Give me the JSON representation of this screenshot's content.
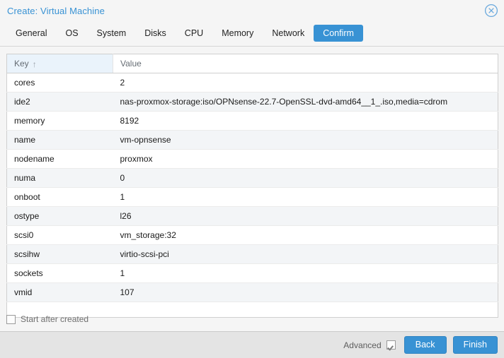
{
  "window": {
    "title": "Create: Virtual Machine",
    "close_icon": "close-circle-icon"
  },
  "tabs": [
    {
      "label": "General",
      "active": false
    },
    {
      "label": "OS",
      "active": false
    },
    {
      "label": "System",
      "active": false
    },
    {
      "label": "Disks",
      "active": false
    },
    {
      "label": "CPU",
      "active": false
    },
    {
      "label": "Memory",
      "active": false
    },
    {
      "label": "Network",
      "active": false
    },
    {
      "label": "Confirm",
      "active": true
    }
  ],
  "grid": {
    "columns": [
      {
        "header": "Key",
        "sorted": true,
        "sort_direction": "asc",
        "sort_glyph": "↑"
      },
      {
        "header": "Value",
        "sorted": false
      }
    ],
    "rows": [
      {
        "key": "cores",
        "value": "2"
      },
      {
        "key": "ide2",
        "value": "nas-proxmox-storage:iso/OPNsense-22.7-OpenSSL-dvd-amd64__1_.iso,media=cdrom"
      },
      {
        "key": "memory",
        "value": "8192"
      },
      {
        "key": "name",
        "value": "vm-opnsense"
      },
      {
        "key": "nodename",
        "value": "proxmox"
      },
      {
        "key": "numa",
        "value": "0"
      },
      {
        "key": "onboot",
        "value": "1"
      },
      {
        "key": "ostype",
        "value": "l26"
      },
      {
        "key": "scsi0",
        "value": "vm_storage:32"
      },
      {
        "key": "scsihw",
        "value": "virtio-scsi-pci"
      },
      {
        "key": "sockets",
        "value": "1"
      },
      {
        "key": "vmid",
        "value": "107"
      }
    ]
  },
  "options": {
    "start_after_created_label": "Start after created",
    "start_after_created_checked": false
  },
  "footer": {
    "advanced_label": "Advanced",
    "advanced_checked": true,
    "back_label": "Back",
    "finish_label": "Finish"
  },
  "colors": {
    "accent": "#3892d4",
    "title": "#3892d4",
    "sorted_column": "#eaf3fb",
    "row_alt": "#f3f5f7",
    "footer_bg": "#e4e4e4"
  }
}
